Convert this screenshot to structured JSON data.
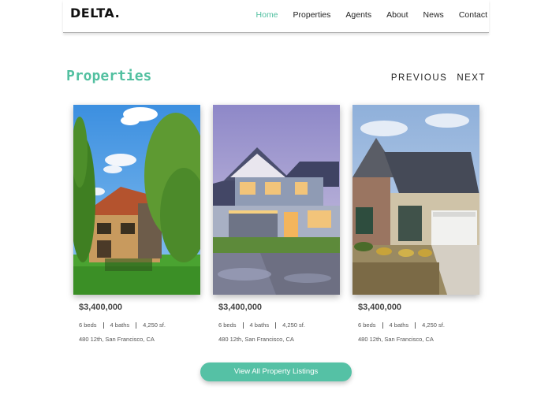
{
  "header": {
    "logo": "DELTA.",
    "nav": [
      "Home",
      "Properties",
      "Agents",
      "About",
      "News",
      "Contact"
    ],
    "active_nav": "Home"
  },
  "section": {
    "title": "Properties",
    "previous": "PREVIOUS",
    "next": "NEXT"
  },
  "properties": [
    {
      "price": "$3,400,000",
      "beds": "6 beds",
      "baths": "4 baths",
      "area": "4,250 sf.",
      "address": "480 12th, San Francisco, CA",
      "image": "brick-house-with-trees"
    },
    {
      "price": "$3,400,000",
      "beds": "6 beds",
      "baths": "4 baths",
      "area": "4,250 sf.",
      "address": "480 12th, San Francisco, CA",
      "image": "two-story-house-at-dusk"
    },
    {
      "price": "$3,400,000",
      "beds": "6 beds",
      "baths": "4 baths",
      "area": "4,250 sf.",
      "address": "480 12th, San Francisco, CA",
      "image": "stone-house-with-garage"
    }
  ],
  "cta": {
    "label": "View All Property Listings"
  },
  "colors": {
    "accent": "#52c0a0",
    "button": "#55c1a5"
  }
}
